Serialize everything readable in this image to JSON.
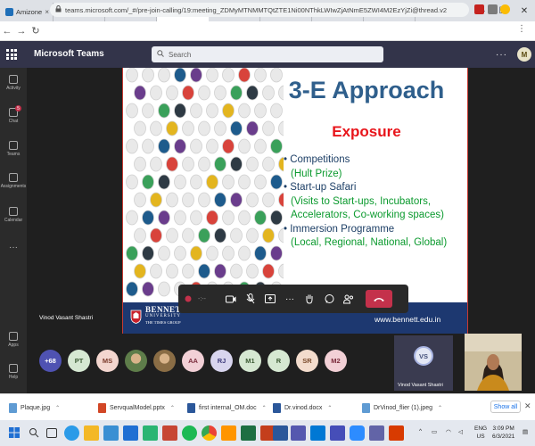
{
  "browser": {
    "tabs": [
      {
        "title": "Amizone",
        "fav": "#1f6fb8"
      },
      {
        "title": "Paper for lite",
        "fav": "#d93025"
      },
      {
        "title": "Invitation fo",
        "fav": "#d93025"
      },
      {
        "title": "Microsof",
        "fav": "#5558af",
        "active": true
      },
      {
        "title": "(5) ED R.N0-",
        "fav": "#5558af"
      },
      {
        "title": "Sign in to yo",
        "fav": "#4285f4"
      },
      {
        "title": "(5) Calendar",
        "fav": "#5558af"
      },
      {
        "title": "New Tab",
        "fav": "#9aa0a6"
      }
    ],
    "url": "teams.microsoft.com/_#/pre-join-calling/19:meeting_ZDMyMTNMMTQtZTE1Ni00NThkLWIwZjAtNmE5ZWI4M2EzYjZi@thread.v2"
  },
  "teams": {
    "app_title": "Microsoft Teams",
    "search_placeholder": "Search",
    "user_initial": "M",
    "rail": [
      {
        "label": "Activity"
      },
      {
        "label": "Chat",
        "badge": "5"
      },
      {
        "label": "Teams"
      },
      {
        "label": "Assignments"
      },
      {
        "label": "Calendar"
      },
      {
        "label": "Apps"
      },
      {
        "label": "Help"
      }
    ]
  },
  "slide": {
    "title": "3-E Approach",
    "subtitle": "Exposure",
    "bullets": [
      {
        "kind": "b",
        "text": "Competitions"
      },
      {
        "kind": "g",
        "text": "(Hult Prize)"
      },
      {
        "kind": "b",
        "text": "Start-up Safari"
      },
      {
        "kind": "g",
        "text": "(Visits to Start-ups, Incubators,"
      },
      {
        "kind": "g",
        "text": "Accelerators, Co-working spaces)"
      },
      {
        "kind": "b",
        "text": "Immersion Programme"
      },
      {
        "kind": "g",
        "text": "(Local, Regional, National, Global)"
      }
    ],
    "logo": {
      "line1": "BENNETT",
      "line2": "UNIVERSITY",
      "line3": "THE TIMES GROUP"
    },
    "url": "www.bennett.edu.in"
  },
  "meeting": {
    "timer": "-:--",
    "presenter_name": "Vinod Vasant Shastri",
    "participants": [
      {
        "initials": "+68",
        "bg": "#4f52b2",
        "fg": "#ffffff"
      },
      {
        "initials": "PT",
        "bg": "#d6e8d2",
        "fg": "#3b5a33"
      },
      {
        "initials": "MS",
        "bg": "#f3d6cf",
        "fg": "#7a3b2b"
      },
      {
        "initials": "",
        "bg": "#5e7d4a",
        "fg": "#ffffff",
        "photo": true
      },
      {
        "initials": "",
        "bg": "#8a6d45",
        "fg": "#ffffff",
        "photo": true
      },
      {
        "initials": "AA",
        "bg": "#f2d0d6",
        "fg": "#7a2b3b"
      },
      {
        "initials": "RJ",
        "bg": "#d8d5ee",
        "fg": "#3d3a7a"
      },
      {
        "initials": "M1",
        "bg": "#d6e8d2",
        "fg": "#3b5a33"
      },
      {
        "initials": "R",
        "bg": "#d6e8d2",
        "fg": "#3b5a33"
      },
      {
        "initials": "SR",
        "bg": "#f3dccd",
        "fg": "#7a4a2b"
      },
      {
        "initials": "M2",
        "bg": "#f2d0d6",
        "fg": "#7a2b3b"
      }
    ],
    "self": {
      "initials": "VS",
      "name": "Vinod Vasant Shastri"
    }
  },
  "downloads": {
    "items": [
      {
        "name": "Plaque.jpg",
        "color": "#5f9bd3"
      },
      {
        "name": "ServqualModel.pptx",
        "color": "#d24726"
      },
      {
        "name": "first internal_OM.doc",
        "color": "#2b579a"
      },
      {
        "name": "Dr.vinod.docx",
        "color": "#2b579a"
      },
      {
        "name": "DrVinod_flier (1).jpeg",
        "color": "#5f9bd3"
      }
    ],
    "show_all": "Show all"
  },
  "taskbar": {
    "lang": "ENG",
    "region": "US",
    "time": "3:09 PM",
    "date": "6/3/2021"
  }
}
